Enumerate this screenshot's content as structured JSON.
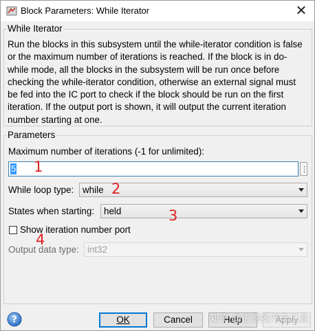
{
  "window": {
    "title": "Block Parameters: While Iterator"
  },
  "block": {
    "name": "While Iterator",
    "description": "Run the blocks in this subsystem until the while-iterator condition is false or the maximum number of iterations is reached.  If the block is in do-while mode, all the blocks in the subsystem will be run once before checking the while-iterator condition, otherwise an external signal must be fed into the IC port to check if the block should be run on the first iteration. If the output port is shown, it will output the current iteration number starting at one."
  },
  "parameters": {
    "legend": "Parameters",
    "max_iter": {
      "label": "Maximum number of iterations (-1 for unlimited):",
      "value": "5",
      "more_label": "⋮"
    },
    "loop_type": {
      "label": "While loop type:",
      "value": "while"
    },
    "states": {
      "label": "States when starting:",
      "value": "held"
    },
    "show_port": {
      "label": "Show iteration number port",
      "checked": false
    },
    "output_type": {
      "label": "Output data type:",
      "value": "int32"
    }
  },
  "annotations": [
    "1",
    "2",
    "3",
    "4"
  ],
  "buttons": {
    "ok": "OK",
    "cancel": "Cancel",
    "help": "Help",
    "apply": "Apply"
  },
  "watermark": "知乎 @古德曼汽车工业",
  "colors": {
    "annotation": "#e02020",
    "selection": "#3399ff",
    "focus_border": "#0078d7"
  }
}
